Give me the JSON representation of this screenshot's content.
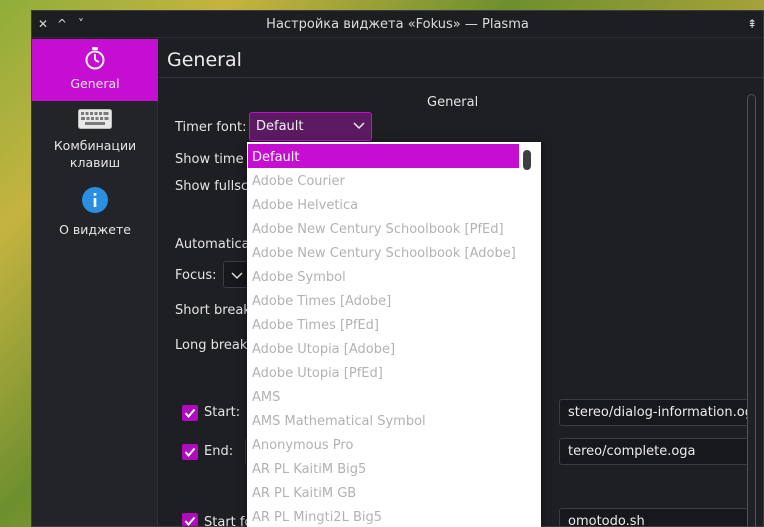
{
  "window": {
    "title": "Настройка виджета «Fokus» — Plasma"
  },
  "titlebar": {
    "close_glyph": "✕",
    "minimize_glyph": "^",
    "maximize_glyph": "˅",
    "keep_above_glyph": "⇞"
  },
  "sidebar": {
    "items": [
      {
        "label": "General",
        "icon": "stopwatch-icon",
        "active": true
      },
      {
        "label": "Комбинации клавиш",
        "icon": "keyboard-icon",
        "active": false
      },
      {
        "label": "О виджете",
        "icon": "info-icon",
        "active": false
      }
    ]
  },
  "main": {
    "page_title": "General",
    "section_title": "General",
    "timer_font_label": "Timer font:",
    "timer_font_value": "Default",
    "show_time_label": "Show time i",
    "show_fullscreen_label": "Show fullscr",
    "automatic_label": "Automatical",
    "focus_label": "Focus:",
    "short_break_label": "Short break:",
    "long_break_label": "Long break:",
    "start_label": "Start:",
    "start_value": "stereo/dialog-information.oga",
    "end_label": "End:",
    "end_value": "tereo/complete.oga",
    "start_fo_label": "Start fo",
    "start_fo_value": "omotodo.sh"
  },
  "dropdown": {
    "items": [
      "Default",
      "Adobe Courier",
      "Adobe Helvetica",
      "Adobe New Century Schoolbook [PfEd]",
      "Adobe New Century Schoolbook [Adobe]",
      "Adobe Symbol",
      "Adobe Times [Adobe]",
      "Adobe Times [PfEd]",
      "Adobe Utopia [Adobe]",
      "Adobe Utopia [PfEd]",
      "AMS",
      "AMS Mathematical Symbol",
      "Anonymous Pro",
      "AR PL KaitiM Big5",
      "AR PL KaitiM GB",
      "AR PL Mingti2L Big5"
    ],
    "selected": "Default"
  },
  "colors": {
    "accent": "#c50ed2",
    "accent_dark": "#5c1a63",
    "window_bg": "#1e1f23",
    "sidebar_bg": "#232428"
  }
}
